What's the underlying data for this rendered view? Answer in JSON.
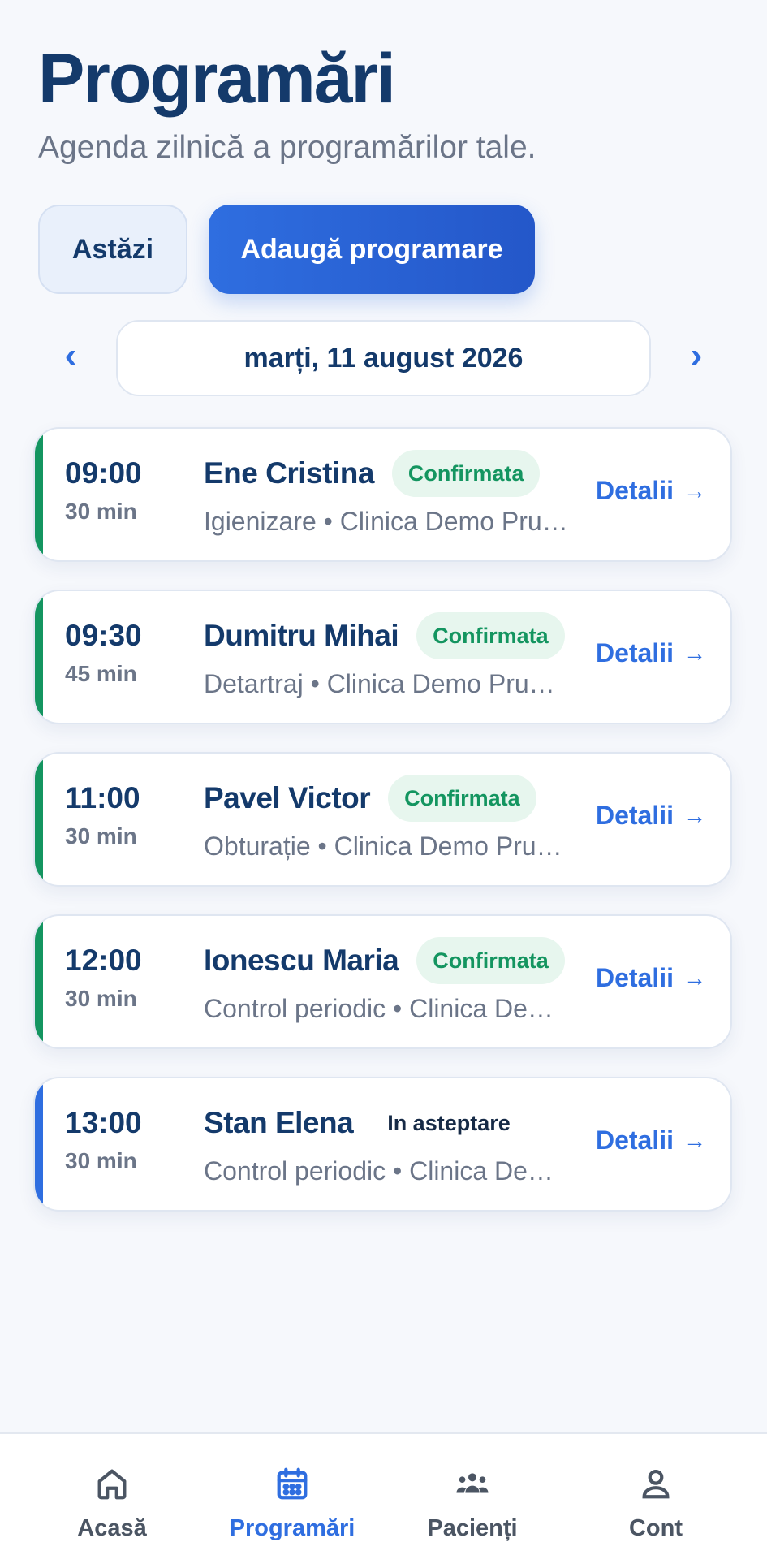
{
  "header": {
    "title": "Programări",
    "subtitle": "Agenda zilnică a programărilor tale."
  },
  "actions": {
    "today_label": "Astăzi",
    "add_label": "Adaugă programare"
  },
  "date_nav": {
    "prev_glyph": "‹",
    "next_glyph": "›",
    "current_date": "marți, 11 august 2026"
  },
  "appointments": [
    {
      "time": "09:00",
      "duration": "30 min",
      "patient": "Ene Cristina",
      "status": "Confirmata",
      "status_kind": "confirmed",
      "meta": "Igienizare • Clinica Demo Pru…",
      "details_label": "Detalii",
      "arrow": "→"
    },
    {
      "time": "09:30",
      "duration": "45 min",
      "patient": "Dumitru Mihai",
      "status": "Confirmata",
      "status_kind": "confirmed",
      "meta": "Detartraj • Clinica Demo Pru…",
      "details_label": "Detalii",
      "arrow": "→"
    },
    {
      "time": "11:00",
      "duration": "30 min",
      "patient": "Pavel Victor",
      "status": "Confirmata",
      "status_kind": "confirmed",
      "meta": "Obturație • Clinica Demo Pru…",
      "details_label": "Detalii",
      "arrow": "→"
    },
    {
      "time": "12:00",
      "duration": "30 min",
      "patient": "Ionescu Maria",
      "status": "Confirmata",
      "status_kind": "confirmed",
      "meta": "Control periodic • Clinica De…",
      "details_label": "Detalii",
      "arrow": "→"
    },
    {
      "time": "13:00",
      "duration": "30 min",
      "patient": "Stan Elena",
      "status": "In asteptare",
      "status_kind": "pending",
      "meta": "Control periodic • Clinica De…",
      "details_label": "Detalii",
      "arrow": "→"
    }
  ],
  "colors": {
    "confirmed_accent": "#149560",
    "pending_accent": "#2f6ee0",
    "primary": "#2f6ee0"
  },
  "bottom_nav": [
    {
      "label": "Acasă",
      "icon": "home-icon",
      "active": false
    },
    {
      "label": "Programări",
      "icon": "calendar-icon",
      "active": true
    },
    {
      "label": "Pacienți",
      "icon": "patients-icon",
      "active": false
    },
    {
      "label": "Cont",
      "icon": "user-icon",
      "active": false
    }
  ]
}
